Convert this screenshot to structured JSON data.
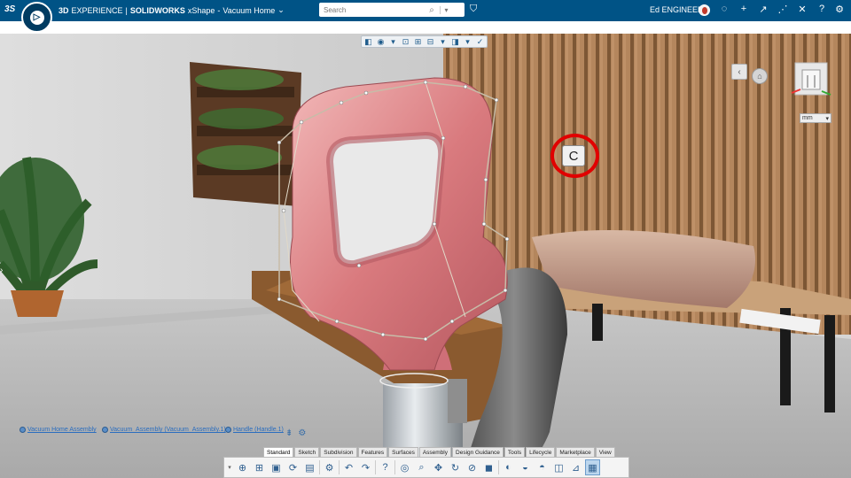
{
  "topbar": {
    "brand_3d": "3D",
    "brand_experience": "EXPERIENCE",
    "brand_divider": "|",
    "brand_solidworks": "SOLIDWORKS",
    "brand_app": "xShape",
    "brand_dash": "-",
    "document_title": "Vacuum Home",
    "title_chevron": "⌄",
    "search_placeholder": "Search",
    "search_icon": "⌕",
    "search_dropdown": "▾",
    "tag_icon": "⛉",
    "user_name": "Ed ENGINEER",
    "icons": [
      {
        "name": "chat-icon",
        "glyph": "◌"
      },
      {
        "name": "add-icon",
        "glyph": "+"
      },
      {
        "name": "share-icon",
        "glyph": "↗"
      },
      {
        "name": "network-icon",
        "glyph": "⋰"
      },
      {
        "name": "tools-icon",
        "glyph": "✕"
      },
      {
        "name": "help-icon",
        "glyph": "?"
      },
      {
        "name": "gear-icon",
        "glyph": "⚙"
      }
    ],
    "ds_logo": "3S",
    "compass_label": "▷",
    "compass_play_label": "V,R"
  },
  "viewport": {
    "key_label": "C",
    "unit_value": "mm",
    "unit_chevron": "▾",
    "prev_view_icon": "‹",
    "home_view_icon": "⌂",
    "left_nav_icon": "›",
    "view_toolbar": [
      "◧",
      "◉",
      "▾",
      "⊡",
      "⊞",
      "⊟",
      "▾",
      "◨",
      "▾",
      "✓"
    ]
  },
  "tree": {
    "items": [
      {
        "label": "Vacuum Home Assembly"
      },
      {
        "label": "Vacuum_Assembly (Vacuum_Assembly.1)"
      },
      {
        "label": "Handle (Handle.1)"
      }
    ],
    "tools": [
      "⇟",
      "⚙"
    ]
  },
  "tabs": [
    {
      "label": "Standard",
      "active": true
    },
    {
      "label": "Sketch"
    },
    {
      "label": "Subdivision"
    },
    {
      "label": "Features"
    },
    {
      "label": "Surfaces"
    },
    {
      "label": "Assembly"
    },
    {
      "label": "Design Guidance"
    },
    {
      "label": "Tools"
    },
    {
      "label": "Lifecycle"
    },
    {
      "label": "Marketplace"
    },
    {
      "label": "View"
    }
  ],
  "action_bar": {
    "grip": "▾",
    "buttons": [
      {
        "name": "new-component-icon",
        "glyph": "⊕"
      },
      {
        "name": "insert-icon",
        "glyph": "⊞"
      },
      {
        "name": "save-icon",
        "glyph": "▣"
      },
      {
        "name": "manage-icon",
        "glyph": "⟳"
      },
      {
        "name": "properties-icon",
        "glyph": "▤"
      },
      {
        "name": "settings-icon",
        "glyph": "⚙"
      },
      {
        "name": "undo-icon",
        "glyph": "↶"
      },
      {
        "name": "redo-icon",
        "glyph": "↷"
      },
      {
        "name": "help-icon",
        "glyph": "?"
      },
      {
        "name": "fit-all-icon",
        "glyph": "◎"
      },
      {
        "name": "zoom-icon",
        "glyph": "⌕"
      },
      {
        "name": "pan-icon",
        "glyph": "✥"
      },
      {
        "name": "rotate-icon",
        "glyph": "↻"
      },
      {
        "name": "zoom-area-icon",
        "glyph": "⊘"
      },
      {
        "name": "view-cube-icon",
        "glyph": "◼"
      },
      {
        "name": "hide-show-icon",
        "glyph": "◐"
      },
      {
        "name": "appearance-icon",
        "glyph": "◒"
      },
      {
        "name": "material-icon",
        "glyph": "◓"
      },
      {
        "name": "section-icon",
        "glyph": "◫"
      },
      {
        "name": "measure-icon",
        "glyph": "⊿"
      },
      {
        "name": "render-icon",
        "glyph": "▦",
        "selected": true
      }
    ]
  }
}
